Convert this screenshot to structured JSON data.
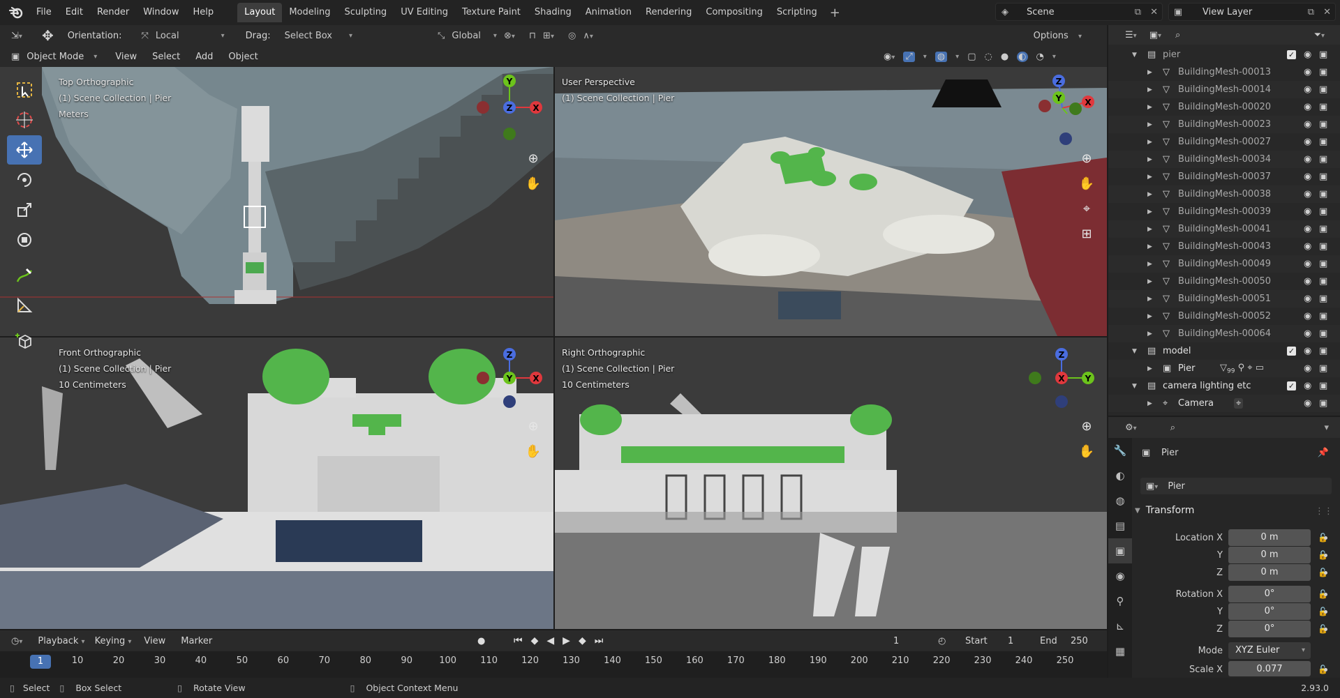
{
  "menu": [
    "File",
    "Edit",
    "Render",
    "Window",
    "Help"
  ],
  "workspaces": [
    "Layout",
    "Modeling",
    "Sculpting",
    "UV Editing",
    "Texture Paint",
    "Shading",
    "Animation",
    "Rendering",
    "Compositing",
    "Scripting"
  ],
  "active_workspace": "Layout",
  "scene": "Scene",
  "view_layer": "View Layer",
  "toolbar_header": {
    "orientation_label": "Orientation:",
    "orientation_value": "Local",
    "drag_label": "Drag:",
    "drag_value": "Select Box",
    "transform_orientation": "Global",
    "options": "Options"
  },
  "viewport_header": {
    "mode": "Object Mode",
    "items": [
      "View",
      "Select",
      "Add",
      "Object"
    ]
  },
  "viewports": {
    "top_left": {
      "title": "Top Orthographic",
      "collection": "(1) Scene Collection | Pier",
      "unit": "Meters"
    },
    "top_right": {
      "title": "User Perspective",
      "collection": "(1) Scene Collection | Pier"
    },
    "bottom_left": {
      "title": "Front Orthographic",
      "collection": "(1) Scene Collection | Pier",
      "unit": "10 Centimeters"
    },
    "bottom_right": {
      "title": "Right Orthographic",
      "collection": "(1) Scene Collection | Pier",
      "unit": "10 Centimeters"
    }
  },
  "gizmo_axes": {
    "x": "X",
    "y": "Y",
    "z": "Z"
  },
  "axis_colors": {
    "x": "#e0383d",
    "y": "#6cc31c",
    "z": "#4a6de0"
  },
  "timeline": {
    "menus": [
      "Playback",
      "Keying",
      "View",
      "Marker"
    ],
    "current_frame": "1",
    "start_label": "Start",
    "start": "1",
    "end_label": "End",
    "end": "250",
    "ticks": [
      "1",
      "10",
      "20",
      "30",
      "40",
      "50",
      "60",
      "70",
      "80",
      "90",
      "100",
      "110",
      "120",
      "130",
      "140",
      "150",
      "160",
      "170",
      "180",
      "190",
      "200",
      "210",
      "220",
      "230",
      "240",
      "250"
    ]
  },
  "status_bar": {
    "select": "Select",
    "box_select": "Box Select",
    "rotate_view": "Rotate View",
    "context_menu": "Object Context Menu",
    "version": "2.93.0"
  },
  "outliner": {
    "collection_pier": "pier",
    "meshes": [
      "BuildingMesh-00013",
      "BuildingMesh-00014",
      "BuildingMesh-00020",
      "BuildingMesh-00023",
      "BuildingMesh-00027",
      "BuildingMesh-00034",
      "BuildingMesh-00037",
      "BuildingMesh-00038",
      "BuildingMesh-00039",
      "BuildingMesh-00041",
      "BuildingMesh-00043",
      "BuildingMesh-00049",
      "BuildingMesh-00050",
      "BuildingMesh-00051",
      "BuildingMesh-00052",
      "BuildingMesh-00064"
    ],
    "collection_model": "model",
    "object_pier": "Pier",
    "modifier_count": "99",
    "collection_camera": "camera lighting etc",
    "object_camera": "Camera"
  },
  "properties": {
    "object_name": "Pier",
    "data_name": "Pier",
    "panel": "Transform",
    "location_x_label": "Location X",
    "y_label": "Y",
    "z_label": "Z",
    "rotation_x_label": "Rotation X",
    "mode_label": "Mode",
    "scale_x_label": "Scale X",
    "location": [
      "0 m",
      "0 m",
      "0 m"
    ],
    "rotation": [
      "0°",
      "0°",
      "0°"
    ],
    "mode": "XYZ Euler",
    "scale_x": "0.077"
  }
}
